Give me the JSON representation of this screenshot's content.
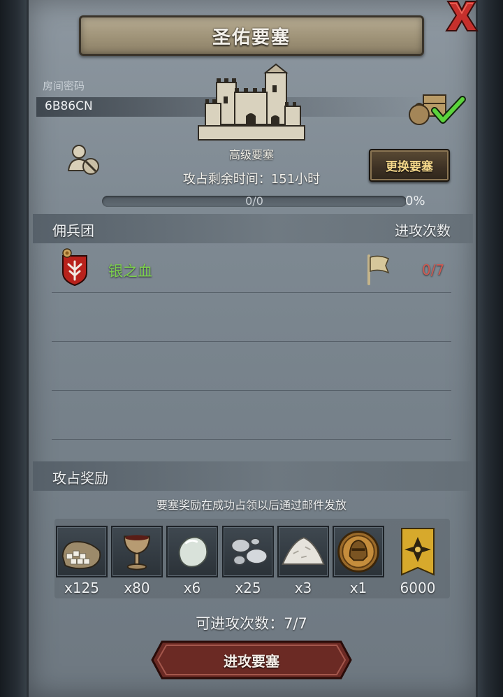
{
  "window": {
    "title": "圣佑要塞",
    "close_icon": "close-x-icon"
  },
  "room": {
    "label": "房间密码",
    "code": "6B86CN"
  },
  "fortress": {
    "type": "高级要塞",
    "change_button": "更换要塞",
    "remaining_time": "攻占剩余时间：151小时",
    "progress_text": "0/0",
    "progress_percent": "0%",
    "progress_value": 0
  },
  "mercenary": {
    "header_left": "佣兵团",
    "header_right": "进攻次数",
    "guilds": [
      {
        "name": "银之血",
        "attacks": "0/7"
      }
    ]
  },
  "rewards": {
    "header": "攻占奖励",
    "note": "要塞奖励在成功占领以后通过邮件发放",
    "items": [
      {
        "icon": "salt-sack-icon",
        "quantity": "x125"
      },
      {
        "icon": "goblet-icon",
        "quantity": "x80"
      },
      {
        "icon": "pearl-stone-icon",
        "quantity": "x6"
      },
      {
        "icon": "silver-ore-icon",
        "quantity": "x25"
      },
      {
        "icon": "salt-pile-icon",
        "quantity": "x3"
      },
      {
        "icon": "knight-medal-icon",
        "quantity": "x1"
      },
      {
        "icon": "gold-banner-icon",
        "quantity": "6000"
      }
    ]
  },
  "footer": {
    "available_attacks": "可进攻次数：7/7",
    "attack_button": "进攻要塞"
  },
  "colors": {
    "guild_name": "#7dcf4e",
    "attack_count": "#cf5a52",
    "change_button_text": "#f4d78a",
    "attack_button": "#6b2a24"
  }
}
